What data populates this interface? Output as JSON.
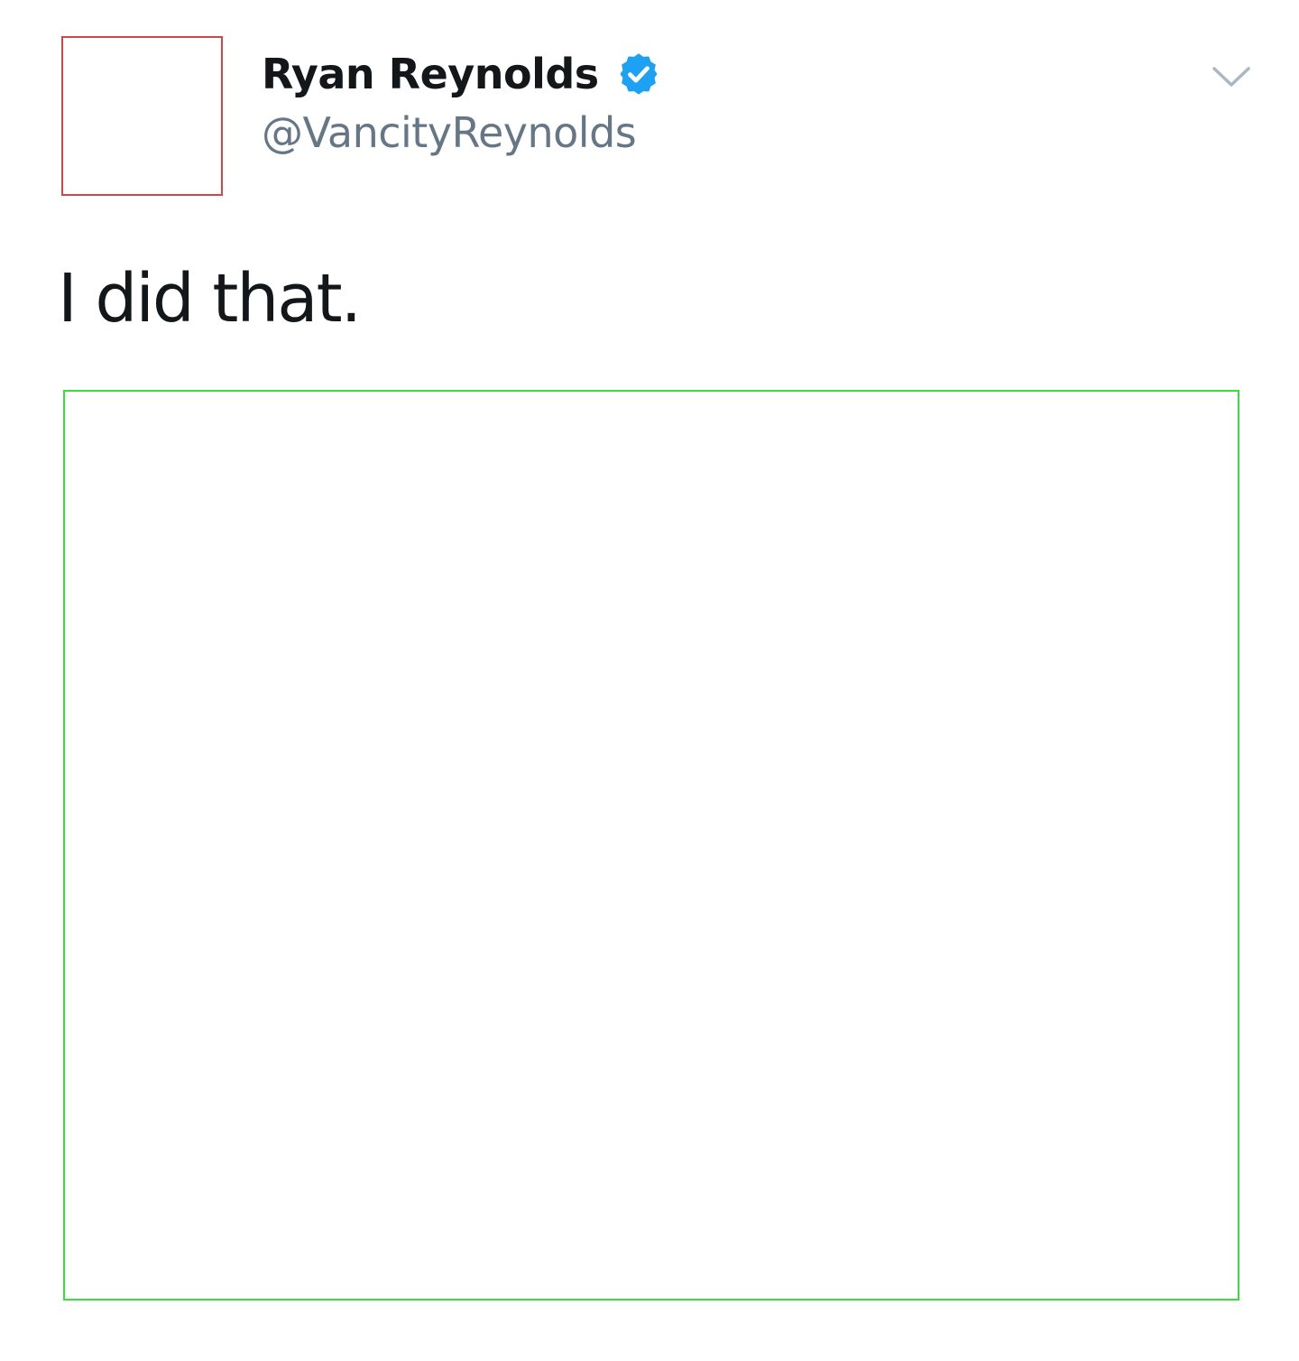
{
  "tweet": {
    "display_name": "Ryan Reynolds",
    "handle": "@VancityReynolds",
    "text": "I did that.",
    "verified": true
  },
  "icons": {
    "verified": "verified-badge-icon",
    "menu": "chevron-down-icon"
  },
  "colors": {
    "verified_badge": "#1da1f2",
    "handle_text": "#657786",
    "primary_text": "#14171a",
    "avatar_outline": "#d64545",
    "media_outline": "#3ddc3d"
  }
}
